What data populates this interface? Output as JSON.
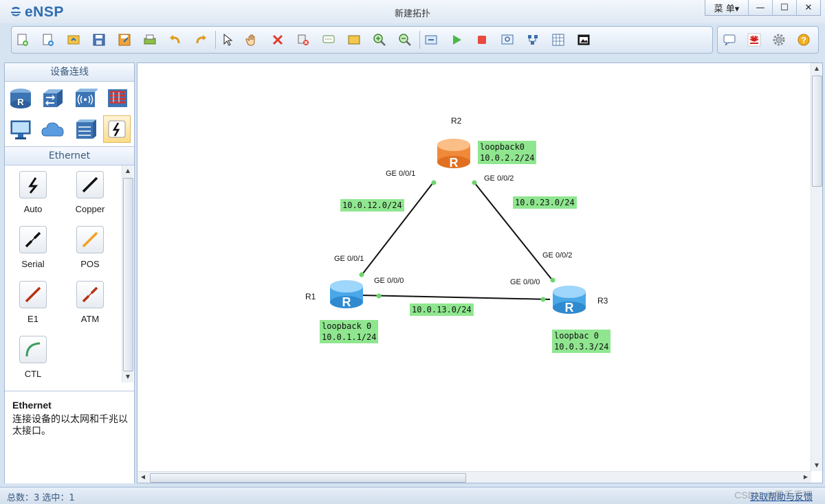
{
  "app": {
    "logo": "eNSP",
    "title": "新建拓扑"
  },
  "window": {
    "menu_label": "菜 单▾",
    "minimize": "—",
    "maximize": "☐",
    "close": "✕"
  },
  "left_panel": {
    "device_header": "设备连线",
    "cable_header": "Ethernet",
    "cables": [
      {
        "label": "Auto",
        "color": "#111111"
      },
      {
        "label": "Copper",
        "color": "#111111"
      },
      {
        "label": "Serial",
        "color": "#111111"
      },
      {
        "label": "POS",
        "color": "#f5a020"
      },
      {
        "label": "E1",
        "color": "#b83212"
      },
      {
        "label": "ATM",
        "color": "#b83212"
      },
      {
        "label": "CTL",
        "color": "#3a9e5c"
      }
    ],
    "description": {
      "title": "Ethernet",
      "text": "连接设备的以太网和千兆以太接口。"
    }
  },
  "topology": {
    "routers": [
      {
        "name": "R1",
        "color": "#4aa8e8"
      },
      {
        "name": "R2",
        "color": "#f08a3a"
      },
      {
        "name": "R3",
        "color": "#4aa8e8"
      }
    ],
    "ports": {
      "r2_left": "GE 0/0/1",
      "r2_right": "GE 0/0/2",
      "r1_top": "GE 0/0/1",
      "r1_right": "GE 0/0/0",
      "r3_top": "GE 0/0/2",
      "r3_left": "GE 0/0/0"
    },
    "notes": {
      "r2_loop": "loopback0\n10.0.2.2/24",
      "r1_loop": "loopback 0\n10.0.1.1/24",
      "r3_loop": "loopbac 0\n10.0.3.3/24",
      "link_12": "10.0.12.0/24",
      "link_23": "10.0.23.0/24",
      "link_13": "10.0.13.0/24"
    }
  },
  "status": {
    "left": "总数：3  选中：1",
    "right": "获取帮助与反馈",
    "watermark": "CSDN @晨手手吧"
  }
}
